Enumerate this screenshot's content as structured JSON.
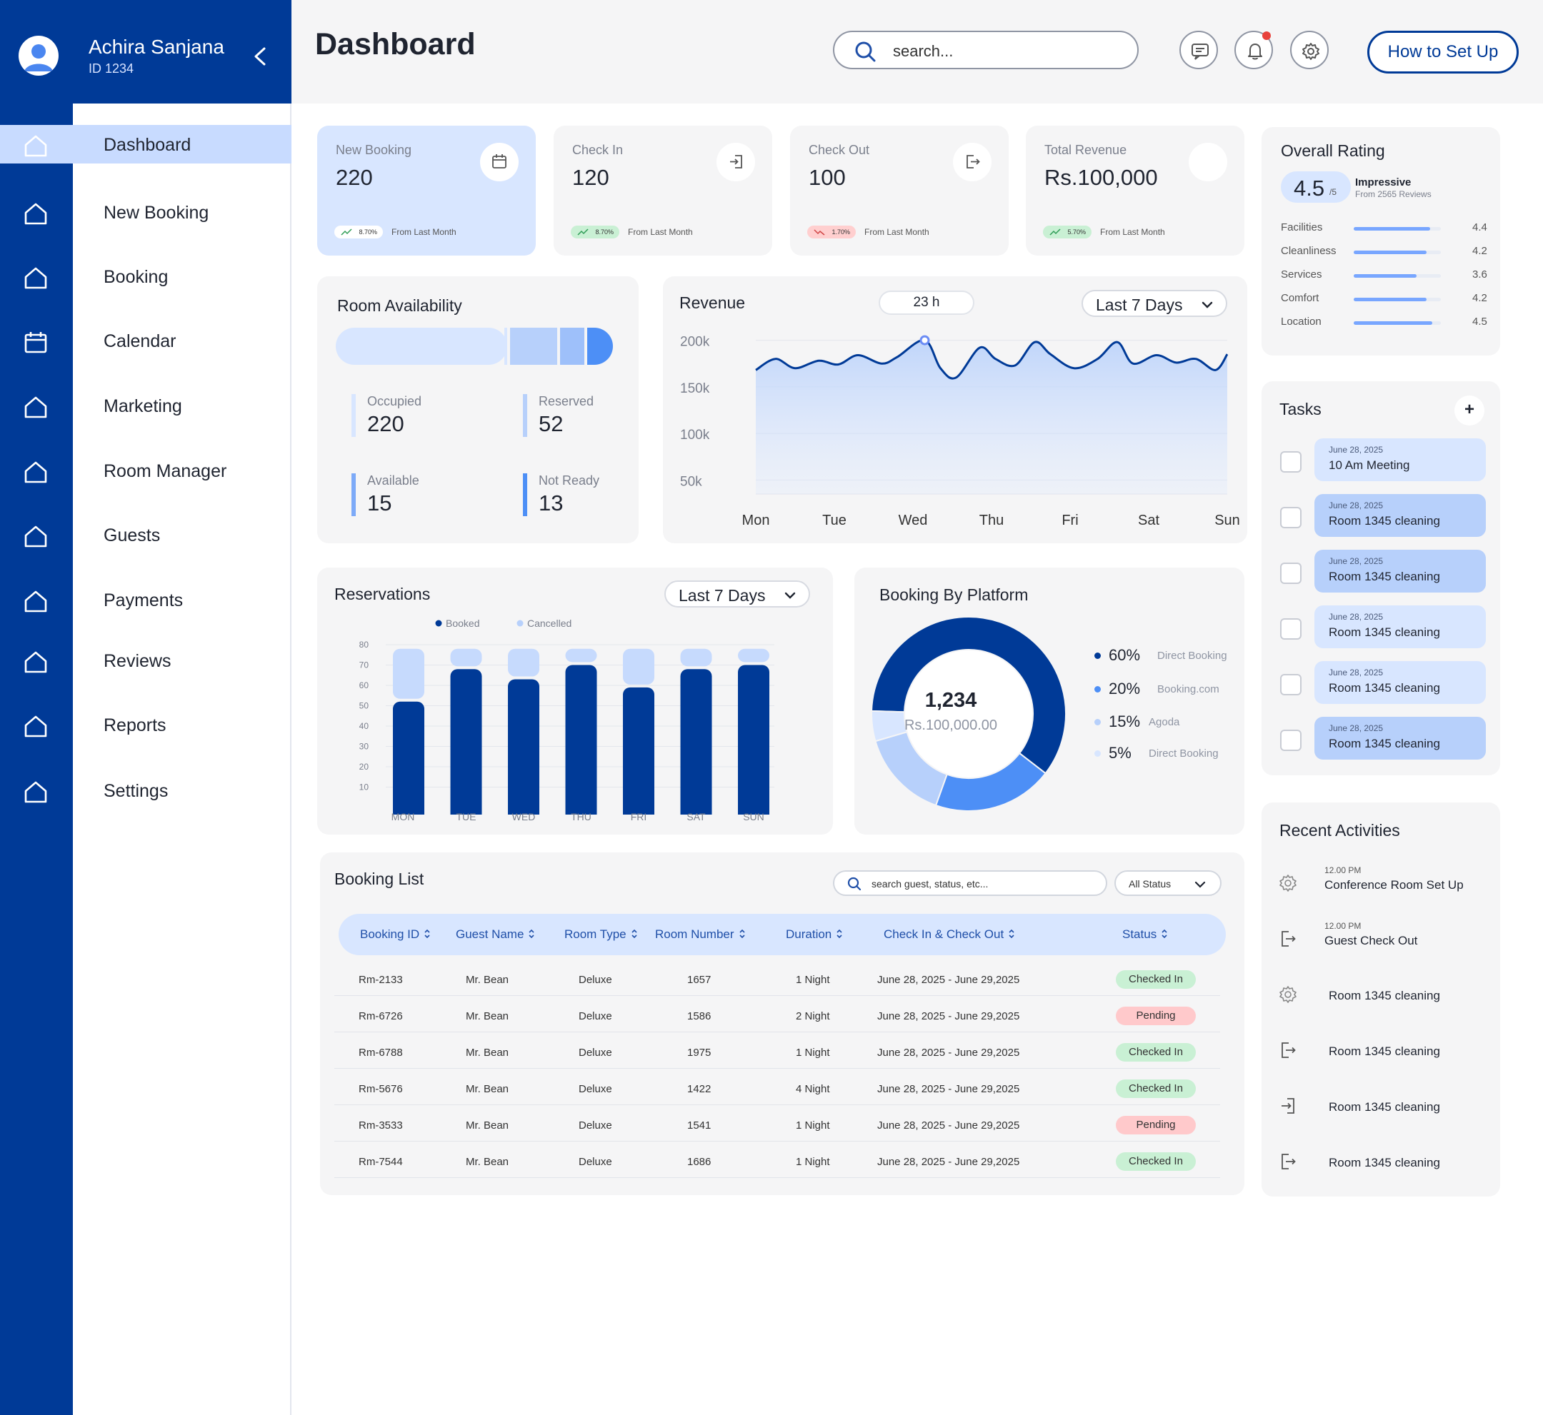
{
  "user": {
    "name": "Achira Sanjana",
    "id": "ID 1234"
  },
  "nav": [
    {
      "label": "Dashboard",
      "icon": "home-icon",
      "active": true
    },
    {
      "label": "New Booking",
      "icon": "home-icon"
    },
    {
      "label": "Booking",
      "icon": "home-icon"
    },
    {
      "label": "Calendar",
      "icon": "calendar-icon"
    },
    {
      "label": "Marketing",
      "icon": "home-icon"
    },
    {
      "label": "Room Manager",
      "icon": "home-icon"
    },
    {
      "label": "Guests",
      "icon": "home-icon"
    },
    {
      "label": "Payments",
      "icon": "home-icon"
    },
    {
      "label": "Reviews",
      "icon": "home-icon"
    },
    {
      "label": "Reports",
      "icon": "home-icon"
    },
    {
      "label": "Settings",
      "icon": "home-icon"
    }
  ],
  "header": {
    "title": "Dashboard",
    "search_placeholder": "search...",
    "setup_label": "How to Set Up"
  },
  "stats": [
    {
      "label": "New Booking",
      "value": "220",
      "change": "8.70%",
      "trend": "up",
      "note": "From Last Month",
      "icon": "calendar-icon"
    },
    {
      "label": "Check In",
      "value": "120",
      "change": "8.70%",
      "trend": "up",
      "note": "From Last Month",
      "icon": "check-in-icon"
    },
    {
      "label": "Check Out",
      "value": "100",
      "change": "1.70%",
      "trend": "down",
      "note": "From Last Month",
      "icon": "check-out-icon"
    },
    {
      "label": "Total Revenue",
      "value": "Rs.100,000",
      "change": "5.70%",
      "trend": "up",
      "note": "From Last Month",
      "icon": ""
    }
  ],
  "room_availability": {
    "title": "Room Availability",
    "items": [
      {
        "label": "Occupied",
        "value": "220"
      },
      {
        "label": "Reserved",
        "value": "52"
      },
      {
        "label": "Available",
        "value": "15"
      },
      {
        "label": "Not Ready",
        "value": "13"
      }
    ]
  },
  "revenue": {
    "title": "Revenue",
    "badge": "23 h",
    "period": "Last 7 Days"
  },
  "reservations": {
    "title": "Reservations",
    "period": "Last 7 Days"
  },
  "booking_platform": {
    "title": "Booking By Platform",
    "center_value": "1,234",
    "center_sub": "Rs.100,000.00"
  },
  "chart_data": [
    {
      "type": "line",
      "title": "Revenue",
      "categories": [
        "Mon",
        "Tue",
        "Wed",
        "Thu",
        "Fri",
        "Sat",
        "Sun"
      ],
      "y_ticks": [
        "200k",
        "150k",
        "100k",
        "50k"
      ],
      "ylim": [
        35,
        215
      ],
      "x": [
        0,
        0.25,
        0.5,
        0.8,
        1.05,
        1.3,
        1.6,
        1.8,
        2.15,
        2.35,
        2.55,
        2.85,
        3.05,
        3.3,
        3.55,
        3.75,
        4.05,
        4.35,
        4.6,
        4.8,
        5.1,
        5.35,
        5.6,
        5.85,
        6.0
      ],
      "values": [
        168,
        180,
        170,
        178,
        174,
        184,
        175,
        182,
        200,
        170,
        160,
        192,
        180,
        173,
        198,
        185,
        170,
        180,
        198,
        175,
        184,
        176,
        180,
        168,
        185
      ],
      "highlight_index": 8,
      "grid": true
    },
    {
      "type": "bar",
      "title": "Reservations",
      "categories": [
        "MON",
        "TUE",
        "WED",
        "THU",
        "FRI",
        "SAT",
        "SUN"
      ],
      "series": [
        {
          "name": "Booked",
          "values": [
            52,
            68,
            63,
            70,
            59,
            68,
            70
          ]
        },
        {
          "name": "Cancelled",
          "values": [
            26,
            10,
            15,
            8,
            19,
            10,
            8
          ]
        }
      ],
      "y_ticks": [
        10,
        20,
        30,
        40,
        50,
        60,
        70,
        80
      ],
      "ylim": [
        0,
        80
      ],
      "legend": "top",
      "grid": true
    },
    {
      "type": "pie",
      "title": "Booking By Platform",
      "slices": [
        {
          "label": "Direct Booking",
          "percent": "60%",
          "value": 60,
          "color": "#003a97"
        },
        {
          "label": "Booking.com",
          "percent": "20%",
          "value": 20,
          "color": "#4d8ff6"
        },
        {
          "label": "Agoda",
          "percent": "15%",
          "value": 15,
          "color": "#b7d0fb"
        },
        {
          "label": "Direct Booking",
          "percent": "5%",
          "value": 5,
          "color": "#d8e6ff"
        }
      ]
    }
  ],
  "rating": {
    "title": "Overall Rating",
    "score": "4.5",
    "out_of": "/5",
    "verdict": "Impressive",
    "reviews": "From 2565 Reviews",
    "items": [
      {
        "label": "Facilities",
        "value": "4.4",
        "score": 4.4
      },
      {
        "label": "Cleanliness",
        "value": "4.2",
        "score": 4.2
      },
      {
        "label": "Services",
        "value": "3.6",
        "score": 3.6
      },
      {
        "label": "Comfort",
        "value": "4.2",
        "score": 4.2
      },
      {
        "label": "Location",
        "value": "4.5",
        "score": 4.5
      }
    ]
  },
  "tasks": {
    "title": "Tasks",
    "add_label": "+",
    "items": [
      {
        "date": "June 28, 2025",
        "title": "10 Am Meeting"
      },
      {
        "date": "June 28, 2025",
        "title": "Room 1345 cleaning"
      },
      {
        "date": "June 28, 2025",
        "title": "Room 1345 cleaning"
      },
      {
        "date": "June 28, 2025",
        "title": "Room 1345 cleaning"
      },
      {
        "date": "June 28, 2025",
        "title": "Room 1345 cleaning"
      },
      {
        "date": "June 28, 2025",
        "title": "Room 1345 cleaning"
      }
    ]
  },
  "activities": {
    "title": "Recent Activities",
    "items": [
      {
        "time": "12.00 PM",
        "title": "Conference Room Set Up",
        "icon": "gear-icon"
      },
      {
        "time": "12.00 PM",
        "title": "Guest Check Out",
        "icon": "check-out-icon"
      },
      {
        "time": "",
        "title": "Room 1345 cleaning",
        "icon": "gear-icon"
      },
      {
        "time": "",
        "title": "Room 1345 cleaning",
        "icon": "check-out-icon"
      },
      {
        "time": "",
        "title": "Room 1345 cleaning",
        "icon": "check-in-icon"
      },
      {
        "time": "",
        "title": "Room 1345 cleaning",
        "icon": "check-out-icon"
      }
    ]
  },
  "booking_list": {
    "title": "Booking List",
    "search_placeholder": "search guest, status, etc...",
    "filter": "All Status",
    "columns": [
      "Booking ID",
      "Guest Name",
      "Room Type",
      "Room Number",
      "Duration",
      "Check In & Check Out",
      "Status"
    ],
    "rows": [
      {
        "id": "Rm-2133",
        "guest": "Mr. Bean",
        "type": "Deluxe",
        "room": "1657",
        "duration": "1 Night",
        "dates": "June 28, 2025 - June 29,2025",
        "status": "Checked In"
      },
      {
        "id": "Rm-6726",
        "guest": "Mr. Bean",
        "type": "Deluxe",
        "room": "1586",
        "duration": "2 Night",
        "dates": "June 28, 2025 - June 29,2025",
        "status": "Pending"
      },
      {
        "id": "Rm-6788",
        "guest": "Mr. Bean",
        "type": "Deluxe",
        "room": "1975",
        "duration": "1 Night",
        "dates": "June 28, 2025 - June 29,2025",
        "status": "Checked In"
      },
      {
        "id": "Rm-5676",
        "guest": "Mr. Bean",
        "type": "Deluxe",
        "room": "1422",
        "duration": "4 Night",
        "dates": "June 28, 2025 - June 29,2025",
        "status": "Checked In"
      },
      {
        "id": "Rm-3533",
        "guest": "Mr. Bean",
        "type": "Deluxe",
        "room": "1541",
        "duration": "1 Night",
        "dates": "June 28, 2025 - June 29,2025",
        "status": "Pending"
      },
      {
        "id": "Rm-7544",
        "guest": "Mr. Bean",
        "type": "Deluxe",
        "room": "1686",
        "duration": "1 Night",
        "dates": "June 28, 2025 - June 29,2025",
        "status": "Checked In"
      }
    ]
  },
  "colors": {
    "brand": "#003a97",
    "accent_light": "#d8e6ff",
    "accent_mid": "#b7d0fb",
    "status_ok": "#c9f0d4",
    "status_pending": "#ffc9cb"
  }
}
